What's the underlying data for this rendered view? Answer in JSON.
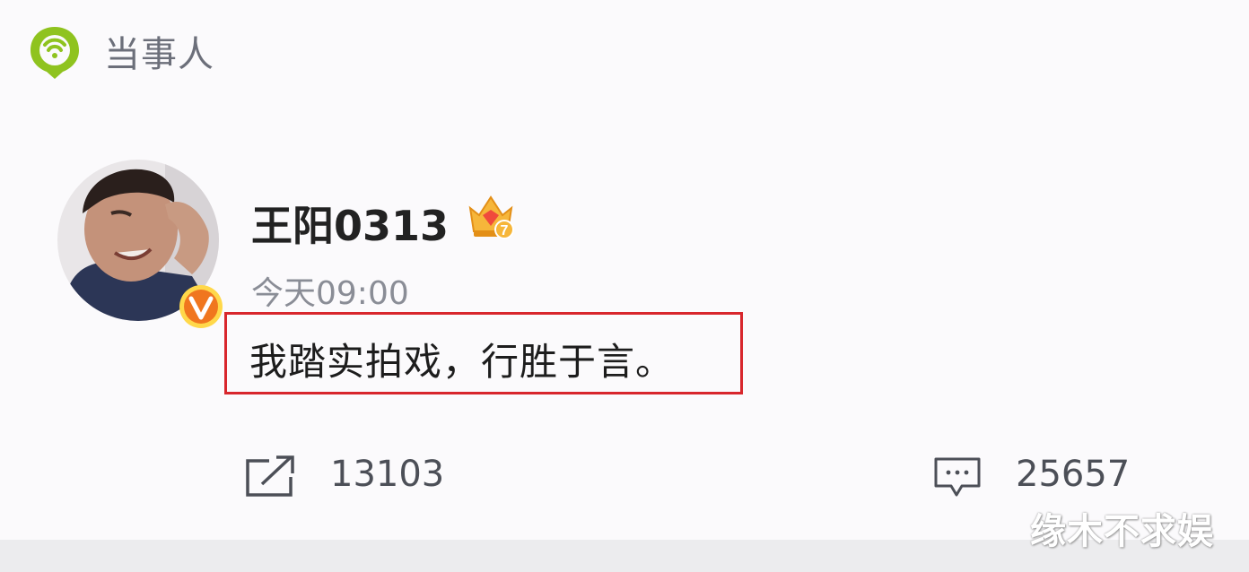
{
  "header": {
    "topic_label": "当事人",
    "logo_icon": "green-topic-bubble-icon"
  },
  "post": {
    "username": "王阳0313",
    "verified_icon": "orange-v-badge-icon",
    "member_icon": "crown-level-7-icon",
    "member_level": "7",
    "time": "今天09:00",
    "text": "我踏实拍戏，行胜于言。",
    "highlight_color": "#d8262c"
  },
  "actions": {
    "share_icon": "share-icon",
    "share_count": "13103",
    "comment_icon": "comment-icon",
    "comment_count": "25657"
  },
  "watermark": "缘木不求娱"
}
